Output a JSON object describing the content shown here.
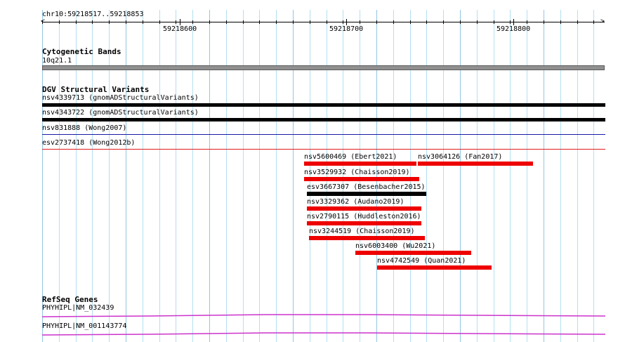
{
  "location": "chr10:59218517..59218853",
  "ruler": {
    "labels": [
      "59218600",
      "59218700",
      "59218800"
    ]
  },
  "cytobands": {
    "title": "Cytogenetic Bands",
    "band": "10q21.1"
  },
  "dgv": {
    "title": "DGV Structural Variants",
    "rows": [
      {
        "label": "nsv4339713 (gnomADStructuralVariants)",
        "color": "#000000"
      },
      {
        "label": "nsv4343722 (gnomADStructuralVariants)",
        "color": "#000000"
      },
      {
        "label": "nsv831888 (Wong2007)",
        "color": "#1a1aa8"
      },
      {
        "label": "esv2737418 (Wong2012b)",
        "color": "#e01c1c"
      }
    ],
    "features": [
      {
        "label": "nsv5600469 (Ebert2021)",
        "color": "#ee0000"
      },
      {
        "label": "nsv3064126 (Fan2017)",
        "color": "#ee0000"
      },
      {
        "label": "nsv3529932 (Chaisson2019)",
        "color": "#ee0000"
      },
      {
        "label": "esv3667307 (Besenbacher2015)",
        "color": "#000000"
      },
      {
        "label": "nsv3329362 (Audano2019)",
        "color": "#ee0000"
      },
      {
        "label": "nsv2790115 (Huddleston2016)",
        "color": "#ee0000"
      },
      {
        "label": "nsv3244519 (Chaisson2019)",
        "color": "#ee0000"
      },
      {
        "label": "nsv6003400 (Wu2021)",
        "color": "#ee0000"
      },
      {
        "label": "nsv4742549 (Quan2021)",
        "color": "#ee0000"
      }
    ]
  },
  "refseq": {
    "title": "RefSeq Genes",
    "genes": [
      {
        "label": "PHYHIPL|NM_032439",
        "color": "#cc33cc"
      },
      {
        "label": "PHYHIPL|NM_001143774",
        "color": "#cc33cc"
      }
    ]
  }
}
